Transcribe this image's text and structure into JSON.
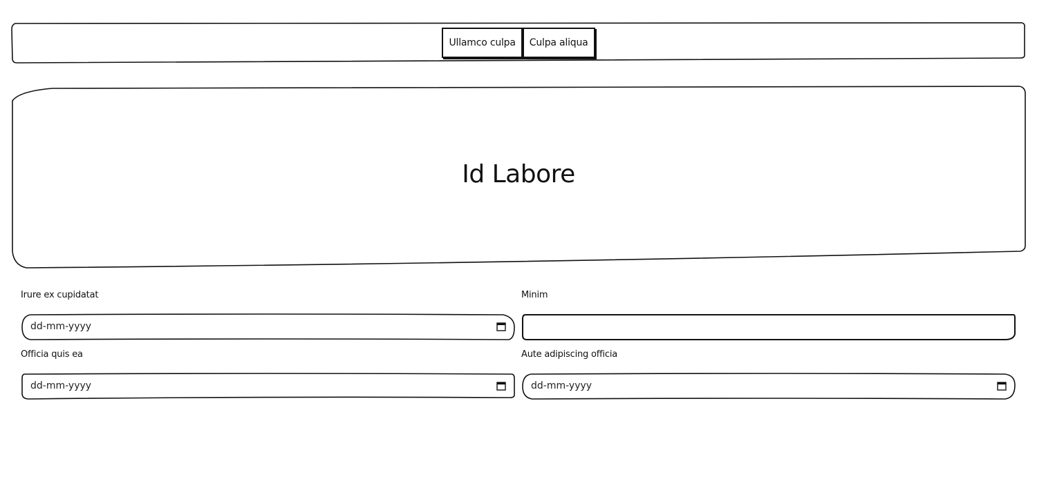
{
  "nav": {
    "buttons": [
      {
        "label": "Ullamco culpa"
      },
      {
        "label": "Culpa aliqua"
      }
    ]
  },
  "hero": {
    "title": "Id Labore"
  },
  "form": {
    "fields": [
      {
        "label": "Irure ex cupidatat",
        "type": "date",
        "placeholder": "dd-mm-yyyy",
        "icon": "calendar-icon"
      },
      {
        "label": "Minim",
        "type": "text",
        "placeholder": ""
      },
      {
        "label": "Officia quis ea",
        "type": "date",
        "placeholder": "dd-mm-yyyy",
        "icon": "calendar-icon"
      },
      {
        "label": "Aute adipiscing officia",
        "type": "date",
        "placeholder": "dd-mm-yyyy",
        "icon": "calendar-icon"
      }
    ]
  },
  "colors": {
    "border": "#111111",
    "background": "#ffffff"
  }
}
